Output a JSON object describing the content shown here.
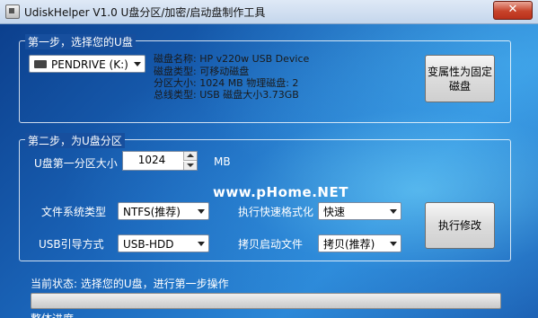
{
  "window": {
    "title": "UdiskHelper V1.0  U盘分区/加密/启动盘制作工具",
    "close_glyph": "✕"
  },
  "step1": {
    "title": "第一步，选择您的U盘",
    "drive": "PENDRIVE (K:)",
    "info": [
      "磁盘名称: HP v220w USB Device",
      "磁盘类型: 可移动磁盘",
      "分区大小: 1024 MB   物理磁盘: 2",
      "总线类型: USB    磁盘大小3.73GB"
    ],
    "change_button": [
      "变属性为固定",
      "磁盘"
    ]
  },
  "step2": {
    "title": "第二步，为U盘分区",
    "partition_label": "U盘第一分区大小",
    "partition_value": "1024",
    "partition_unit": "MB",
    "fs_label": "文件系统类型",
    "fs_value": "NTFS(推荐)",
    "quick_label": "执行快速格式化",
    "quick_value": "快速",
    "boot_label": "USB引导方式",
    "boot_value": "USB-HDD",
    "copy_label": "拷贝启动文件",
    "copy_value": "拷贝(推荐)",
    "execute_button": "执行修改"
  },
  "status": {
    "current": "当前状态: 选择您的U盘，进行第一步操作",
    "overall": "整体进度"
  },
  "watermark": "www.pHome.NET"
}
